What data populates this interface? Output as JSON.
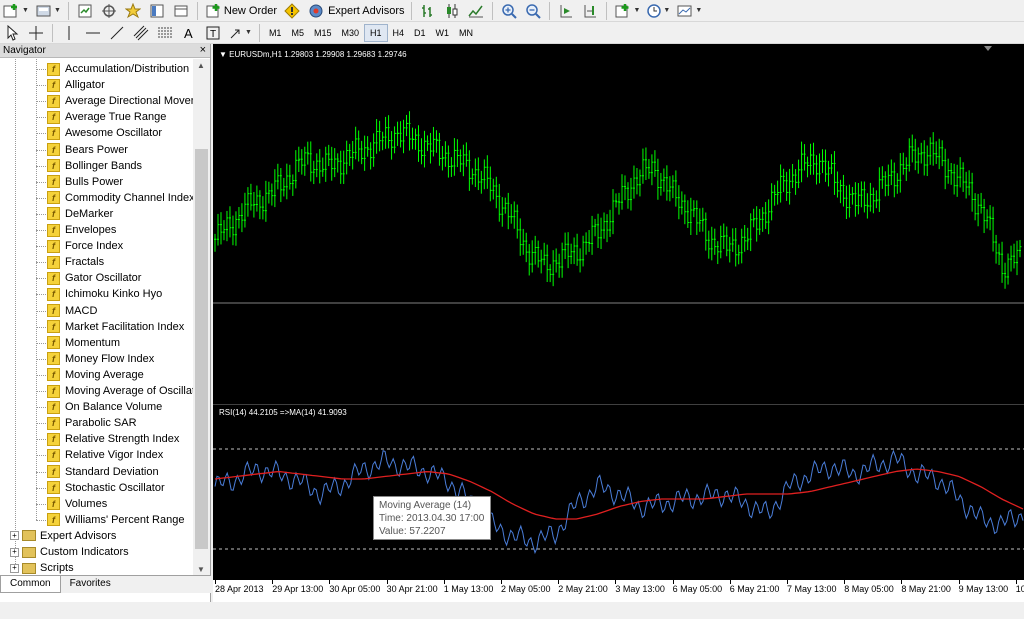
{
  "toolbar1": {
    "new_order_label": "New Order",
    "expert_advisors_label": "Expert Advisors"
  },
  "toolbar2": {
    "timeframes": [
      "M1",
      "M5",
      "M15",
      "M30",
      "H1",
      "H4",
      "D1",
      "W1",
      "MN"
    ],
    "active_timeframe": "H1"
  },
  "navigator": {
    "title": "Navigator",
    "close": "×",
    "indicators": [
      "Accumulation/Distribution",
      "Alligator",
      "Average Directional Moven",
      "Average True Range",
      "Awesome Oscillator",
      "Bears Power",
      "Bollinger Bands",
      "Bulls Power",
      "Commodity Channel Index",
      "DeMarker",
      "Envelopes",
      "Force Index",
      "Fractals",
      "Gator Oscillator",
      "Ichimoku Kinko Hyo",
      "MACD",
      "Market Facilitation Index",
      "Momentum",
      "Money Flow Index",
      "Moving Average",
      "Moving Average of Oscillat",
      "On Balance Volume",
      "Parabolic SAR",
      "Relative Strength Index",
      "Relative Vigor Index",
      "Standard Deviation",
      "Stochastic Oscillator",
      "Volumes",
      "Williams' Percent Range"
    ],
    "folders": [
      "Expert Advisors",
      "Custom Indicators",
      "Scripts"
    ],
    "tabs": [
      "Common",
      "Favorites"
    ],
    "active_tab": "Common",
    "indicator_icon_glyph": "f",
    "expand_glyph": "+"
  },
  "chart": {
    "symbol_line": "EURUSDm,H1  1.29803 1.29908 1.29683 1.29746",
    "rsi_line": "RSI(14) 44.2105  =>MA(14) 41.9093",
    "tooltip": {
      "title": "Moving Average (14)",
      "time": "Time: 2013.04.30 17:00",
      "value": "Value: 57.2207"
    },
    "time_labels": [
      "28 Apr 2013",
      "29 Apr 13:00",
      "30 Apr 05:00",
      "30 Apr 21:00",
      "1 May 13:00",
      "2 May 05:00",
      "2 May 21:00",
      "3 May 13:00",
      "6 May 05:00",
      "6 May 21:00",
      "7 May 13:00",
      "8 May 05:00",
      "8 May 21:00",
      "9 May 13:00",
      "10"
    ],
    "colors": {
      "background": "#000000",
      "candles": "#00ff00",
      "rsi": "#4a7dd8",
      "ma": "#e02020",
      "levels": "#c0c0c0"
    }
  },
  "chart_data": {
    "type": "line",
    "series": [
      {
        "name": "EURUSDm,H1",
        "values": [
          1.3045,
          1.3055,
          1.3065,
          1.307,
          1.308,
          1.309,
          1.3085,
          1.309,
          1.3095,
          1.31,
          1.3105,
          1.31,
          1.3095,
          1.309,
          1.3085,
          1.3075,
          1.306,
          1.304,
          1.303,
          1.3035,
          1.304,
          1.305,
          1.3065,
          1.308,
          1.3085,
          1.307,
          1.306,
          1.3045,
          1.304,
          1.3045,
          1.306,
          1.3075,
          1.3085,
          1.309,
          1.3075,
          1.3065,
          1.307,
          1.308,
          1.309,
          1.3095,
          1.3085,
          1.3075,
          1.306,
          1.303,
          1.3035
        ]
      },
      {
        "name": "RSI(14)",
        "values": [
          55,
          58,
          62,
          60,
          57,
          52,
          56,
          62,
          65,
          63,
          61,
          57,
          49,
          40,
          35,
          33,
          36,
          48,
          55,
          52,
          47,
          48,
          50,
          51,
          52,
          48,
          44,
          55,
          60,
          63,
          60,
          63,
          66,
          60,
          58,
          50,
          42,
          40,
          44
        ]
      },
      {
        "name": "MA(14)",
        "values": [
          58,
          59,
          60,
          61,
          60,
          59,
          58,
          58,
          59,
          60,
          61,
          60,
          57,
          53,
          48,
          44,
          42,
          42,
          44,
          47,
          49,
          50,
          50,
          50,
          51,
          52,
          52,
          52,
          53,
          55,
          57,
          59,
          61,
          62,
          61,
          59,
          55,
          50,
          46
        ]
      }
    ]
  }
}
